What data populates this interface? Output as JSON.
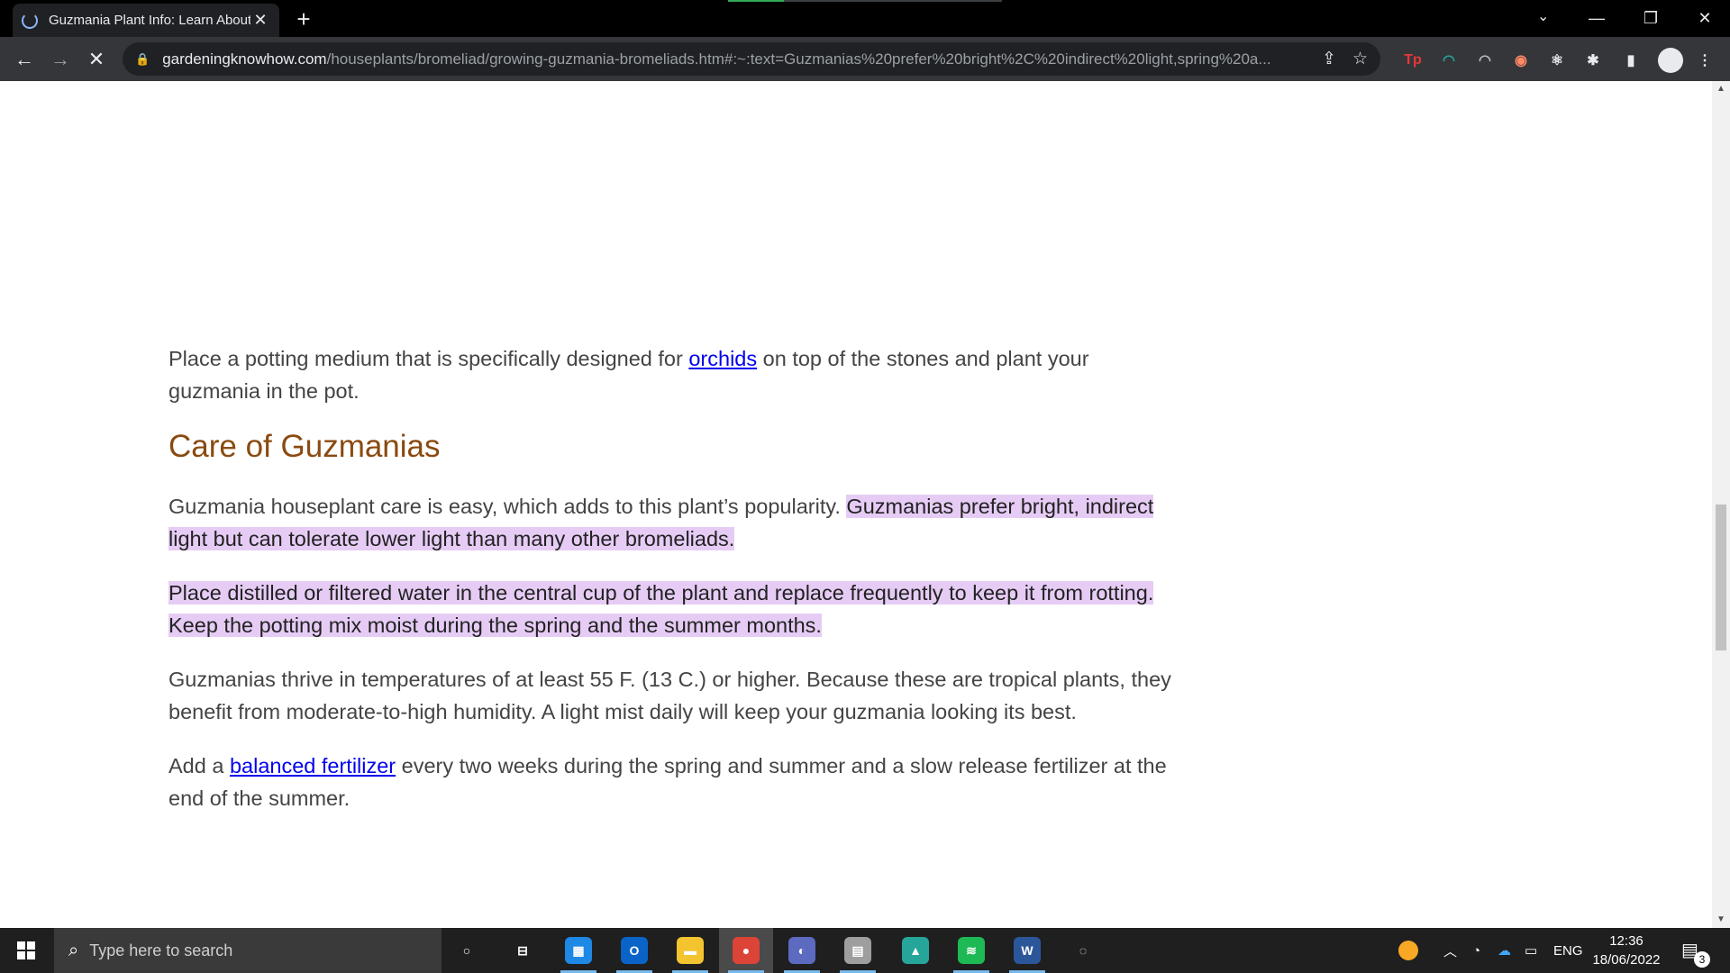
{
  "browser": {
    "tab": {
      "title": "Guzmania Plant Info: Learn About Growing Guzmania Bromeliads"
    },
    "new_tab_label": "+",
    "address": {
      "host": "gardeningknowhow.com",
      "path": "/houseplants/bromeliad/growing-guzmania-bromeliads.htm#:~:text=Guzmanias%20prefer%20bright%2C%20indirect%20light,spring%20a..."
    },
    "extensions": [
      {
        "name": "tp-extension-icon",
        "label": "Tp",
        "color": "#e53935"
      },
      {
        "name": "speed-extension-icon",
        "label": "◠",
        "color": "#26a69a"
      },
      {
        "name": "arch-extension-icon",
        "label": "◠",
        "color": "#bdbdbd"
      },
      {
        "name": "eyes-extension-icon",
        "label": "◉",
        "color": "#ff8a65"
      },
      {
        "name": "react-extension-icon",
        "label": "⚛",
        "color": "#e8eaed"
      },
      {
        "name": "puzzle-extension-icon",
        "label": "✱",
        "color": "#e8eaed"
      },
      {
        "name": "sidepanel-icon",
        "label": "▮",
        "color": "#e8eaed"
      }
    ]
  },
  "article": {
    "para_potting": {
      "before": "Place a potting medium that is specifically designed for ",
      "link": "orchids",
      "after": " on top of the stones and plant your guzmania in the pot."
    },
    "heading": "Care of Guzmanias",
    "para_care": {
      "plain": "Guzmania houseplant care is easy, which adds to this plant’s popularity. ",
      "highlight": "Guzmanias prefer bright, indirect light but can tolerate lower light than many other bromeliads."
    },
    "para_water": {
      "highlight": "Place distilled or filtered water in the central cup of the plant and replace frequently to keep it from rotting. Keep the potting mix moist during the spring and the summer months."
    },
    "para_temp": "Guzmanias thrive in temperatures of at least 55 F. (13 C.) or higher. Because these are tropical plants, they benefit from moderate-to-high humidity. A light mist daily will keep your guzmania looking its best.",
    "para_fert": {
      "before": "Add a ",
      "link": "balanced fertilizer",
      "after": " every two weeks during the spring and summer and a slow release fertilizer at the end of the summer."
    }
  },
  "taskbar": {
    "search_placeholder": "Type here to search",
    "apps": [
      {
        "name": "cortana-icon",
        "label": "○",
        "bg": "transparent",
        "active": false
      },
      {
        "name": "task-view-icon",
        "label": "⊟",
        "bg": "transparent",
        "active": false
      },
      {
        "name": "calendar-app-icon",
        "label": "▦",
        "bg": "#1e88e5",
        "active": true
      },
      {
        "name": "outlook-app-icon",
        "label": "O",
        "bg": "#0a64c8",
        "active": true
      },
      {
        "name": "file-explorer-icon",
        "label": "▬",
        "bg": "#f4c430",
        "active": true
      },
      {
        "name": "chrome-app-icon",
        "label": "●",
        "bg": "#db4437",
        "active": true,
        "focused": true
      },
      {
        "name": "discord-like-app-icon",
        "label": "◐",
        "bg": "#5c6bc0",
        "active": true
      },
      {
        "name": "printer-app-icon",
        "label": "▤",
        "bg": "#9e9e9e",
        "active": true
      },
      {
        "name": "arc-app-icon",
        "label": "▲",
        "bg": "#26a69a",
        "active": false
      },
      {
        "name": "spotify-app-icon",
        "label": "≋",
        "bg": "#1db954",
        "active": true
      },
      {
        "name": "word-app-icon",
        "label": "W",
        "bg": "#2b579a",
        "active": true
      },
      {
        "name": "ring-app-icon",
        "label": "◌",
        "bg": "transparent",
        "active": false
      }
    ],
    "tray": {
      "language": "ENG",
      "time": "12:36",
      "date": "18/06/2022",
      "notification_count": "3"
    }
  }
}
